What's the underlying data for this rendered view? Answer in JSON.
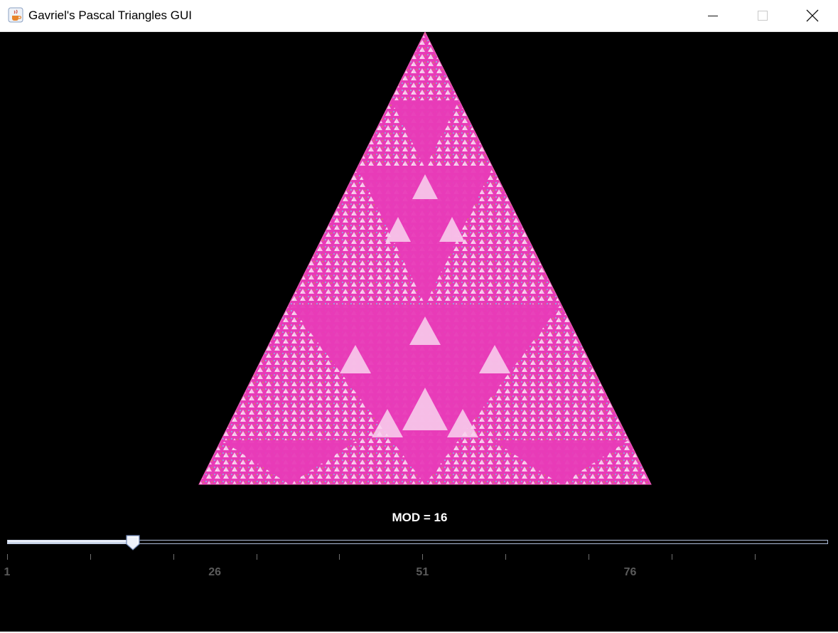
{
  "window": {
    "title": "Gavriel's Pascal Triangles GUI",
    "icon": "java-cup-icon",
    "controls": [
      "minimize-icon",
      "maximize-icon",
      "close-icon"
    ]
  },
  "slider": {
    "label": "MOD = 16",
    "min": 1,
    "max": 100,
    "value": 16,
    "major_tick_labels": [
      "1",
      "26",
      "51",
      "76"
    ]
  },
  "colors": {
    "background": "#000000",
    "triangle_pink": "#e83bb8",
    "titlebar": "#ffffff"
  }
}
